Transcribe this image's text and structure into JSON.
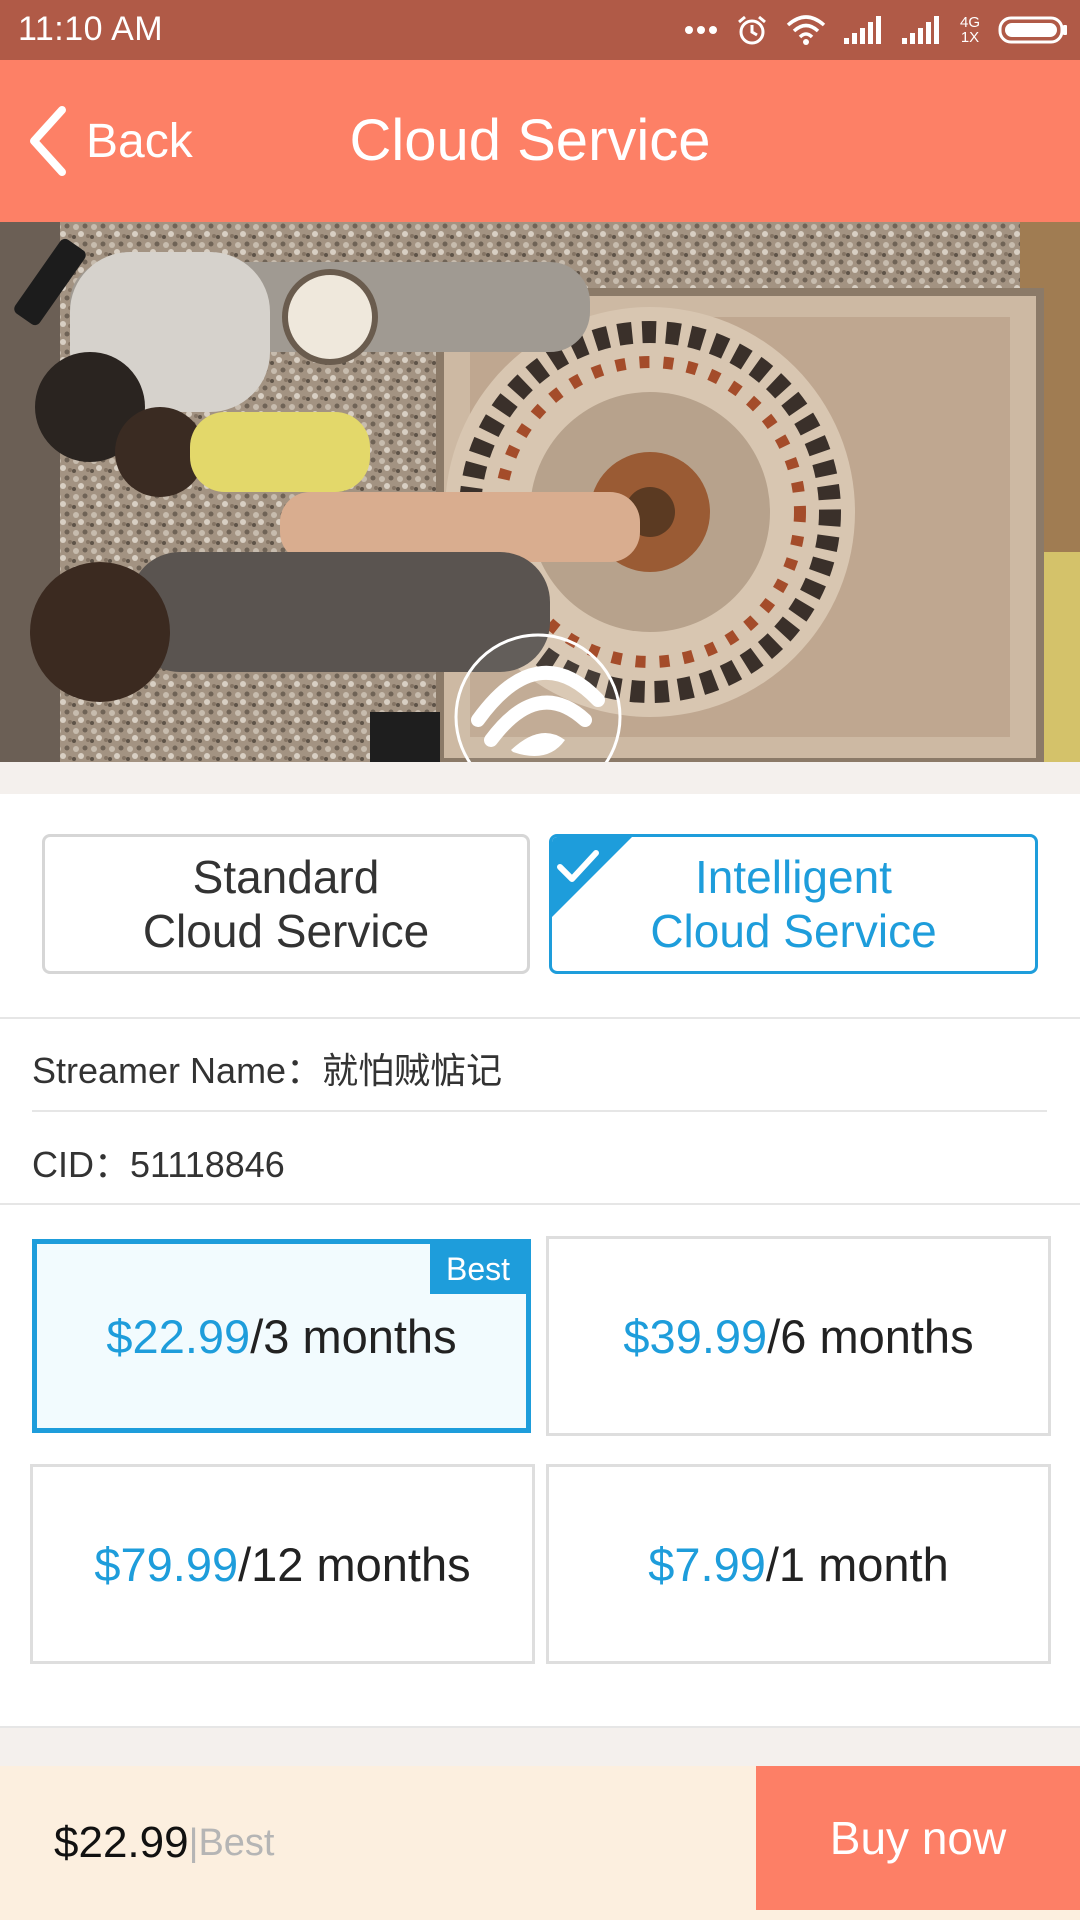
{
  "status_bar": {
    "time": "11:10  AM",
    "network_type": "4G",
    "network_sub": "1X"
  },
  "header": {
    "back_label": "Back",
    "title": "Cloud Service"
  },
  "service_types": [
    {
      "line1": "Standard",
      "line2": "Cloud Service",
      "selected": false
    },
    {
      "line1": "Intelligent",
      "line2": "Cloud Service",
      "selected": true
    }
  ],
  "device": {
    "streamer_label": "Streamer Name：",
    "streamer_name": "就怕贼惦记",
    "cid_label": "CID：",
    "cid_value": "51118846"
  },
  "plans": [
    {
      "price": "$22.99",
      "period": "/3 months",
      "badge": "Best",
      "selected": true
    },
    {
      "price": "$39.99",
      "period": "/6 months",
      "badge": "",
      "selected": false
    },
    {
      "price": "$79.99",
      "period": "/12 months",
      "badge": "",
      "selected": false
    },
    {
      "price": "$7.99",
      "period": "/1 month",
      "badge": "",
      "selected": false
    }
  ],
  "footer": {
    "total": "$22.99",
    "separator": "|",
    "plan_label": " Best",
    "buy_label": "Buy now"
  },
  "colors": {
    "header_bg": "#fd8066",
    "status_bg": "#b05a47",
    "accent": "#1e9ddb",
    "footer_bg": "#fcefdf",
    "buy_bg": "#fd7f66"
  },
  "icons": [
    "back-chevron-icon",
    "more-dots-icon",
    "alarm-icon",
    "wifi-icon",
    "signal-icon",
    "battery-icon",
    "cloud-logo-icon",
    "checkmark-icon"
  ]
}
